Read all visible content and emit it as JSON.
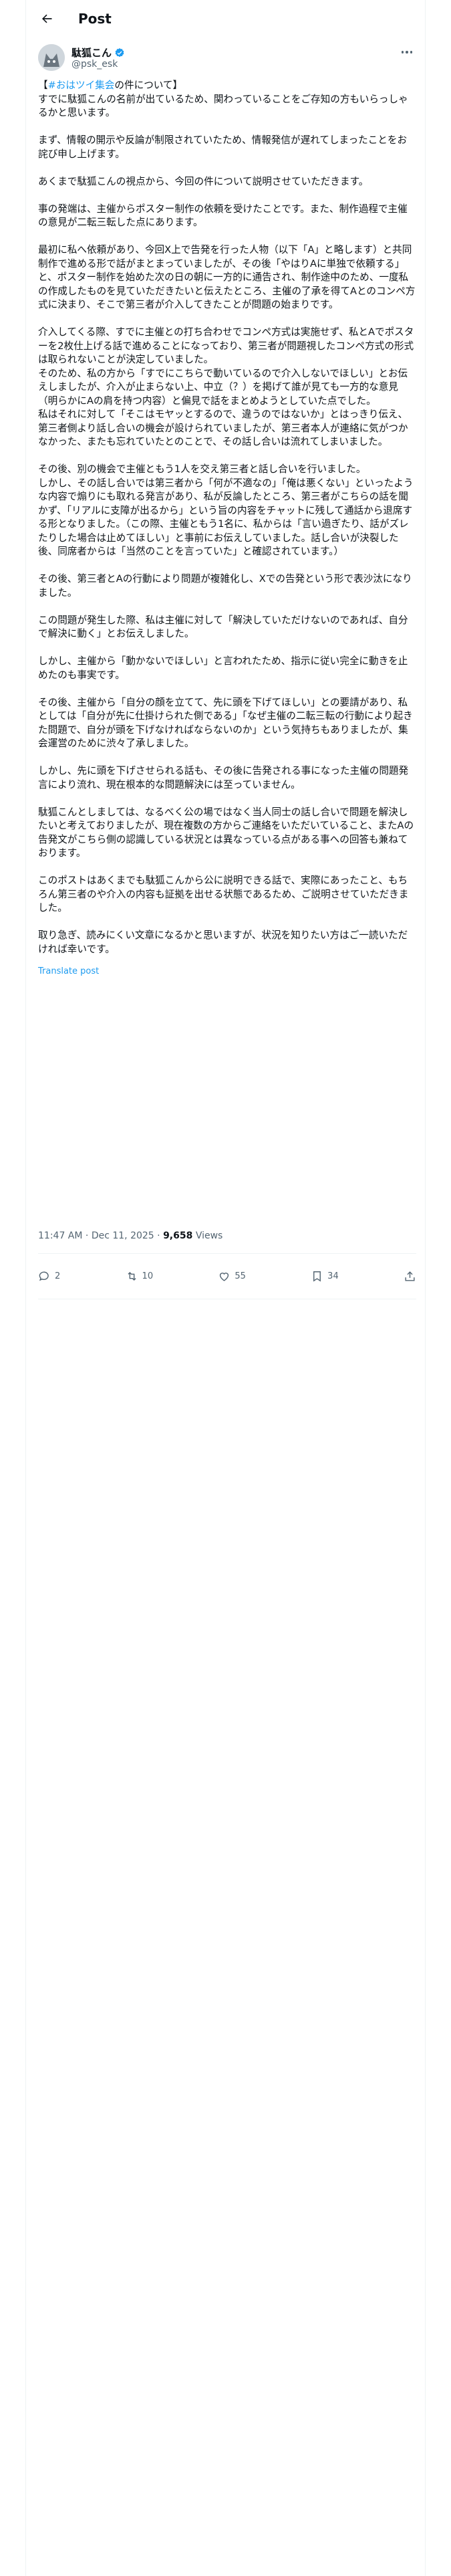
{
  "header": {
    "title": "Post"
  },
  "author": {
    "name": "駄狐こん",
    "handle": "@psk_esk",
    "verified_color": "#1d9bf0"
  },
  "post": {
    "hashtag": "#おはツイ集会",
    "paragraphs": [
      "【#おはツイ集会の件について】\nすでに駄狐こんの名前が出ているため、関わっていることをご存知の方もいらっしゃるかと思います。",
      "まず、情報の開示や反論が制限されていたため、情報発信が遅れてしまったことをお詫び申し上げます。",
      "あくまで駄狐こんの視点から、今回の件について説明させていただきます。",
      "事の発端は、主催からポスター制作の依頼を受けたことです。また、制作過程で主催の意見が二転三転した点にあります。",
      "最初に私へ依頼があり、今回X上で告発を行った人物（以下「A」と略します）と共同制作で進める形で話がまとまっていましたが、その後「やはりAに単独で依頼する」と、ポスター制作を始めた次の日の朝に一方的に通告され、制作途中のため、一度私の作成したものを見ていただきたいと伝えたところ、主催の了承を得てAとのコンペ方式に決まり、そこで第三者が介入してきたことが問題の始まりです。",
      "介入してくる際、すでに主催との打ち合わせでコンペ方式は実施せず、私とAでポスターを2枚仕上げる話で進めることになっており、第三者が問題視したコンペ方式の形式は取られないことが決定していました。\nそのため、私の方から「すでにこちらで動いているので介入しないでほしい」とお伝えしましたが、介入が止まらない上、中立（？）を掲げて誰が見ても一方的な意見（明らかにAの肩を持つ内容）と偏見で話をまとめようとしていた点でした。\n私はそれに対して「そこはモヤッとするので、違うのではないか」とはっきり伝え、第三者側より話し合いの機会が設けられていましたが、第三者本人が連絡に気がつかなかった、またも忘れていたとのことで、その話し合いは流れてしまいました。",
      "その後、別の機会で主催ともう1人を交え第三者と話し合いを行いました。\nしかし、その話し合いでは第三者から「何が不適なの」「俺は悪くない」といったような内容で煽りにも取れる発言があり、私が反論したところ、第三者がこちらの話を聞かず、「リアルに支障が出るから」という旨の内容をチャットに残して通話から退席する形となりました。（この際、主催ともう1名に、私からは「言い過ぎたり、話がズレたりした場合は止めてほしい」と事前にお伝えしていました。話し合いが決裂した後、同席者からは「当然のことを言っていた」と確認されています。）",
      "その後、第三者とAの行動により問題が複雑化し、Xでの告発という形で表沙汰になりました。",
      "この問題が発生した際、私は主催に対して「解決していただけないのであれば、自分で解決に動く」とお伝えしました。",
      "しかし、主催から「動かないでほしい」と言われたため、指示に従い完全に動きを止めたのも事実です。",
      "その後、主催から「自分の顔を立てて、先に頭を下げてほしい」との要請があり、私としては「自分が先に仕掛けられた側である」「なぜ主催の二転三転の行動により起きた問題で、自分が頭を下げなければならないのか」という気持ちもありましたが、集会運営のために渋々了承しました。",
      "しかし、先に頭を下げさせられる話も、その後に告発される事になった主催の問題発言により流れ、現在根本的な問題解決には至っていません。",
      "駄狐こんとしましては、なるべく公の場ではなく当人同士の話し合いで問題を解決したいと考えておりましたが、現在複数の方からご連絡をいただいていること、またAの告発文がこちら側の認識している状況とは異なっている点がある事への回答も兼ねております。",
      "このポストはあくまでも駄狐こんから公に説明できる話で、実際にあったこと、もちろん第三者のや介入の内容も証拠を出せる状態であるため、ご説明させていただきました。",
      "取り急ぎ、読みにくい文章になるかと思いますが、状況を知りたい方はご一読いただければ幸いです。"
    ],
    "translate_label": "Translate post"
  },
  "meta": {
    "time": "11:47 AM",
    "date": "Dec 11, 2025",
    "views": "9,658",
    "views_label": "Views"
  },
  "actions": {
    "replies": "2",
    "reposts": "10",
    "likes": "55",
    "bookmarks": "34"
  }
}
